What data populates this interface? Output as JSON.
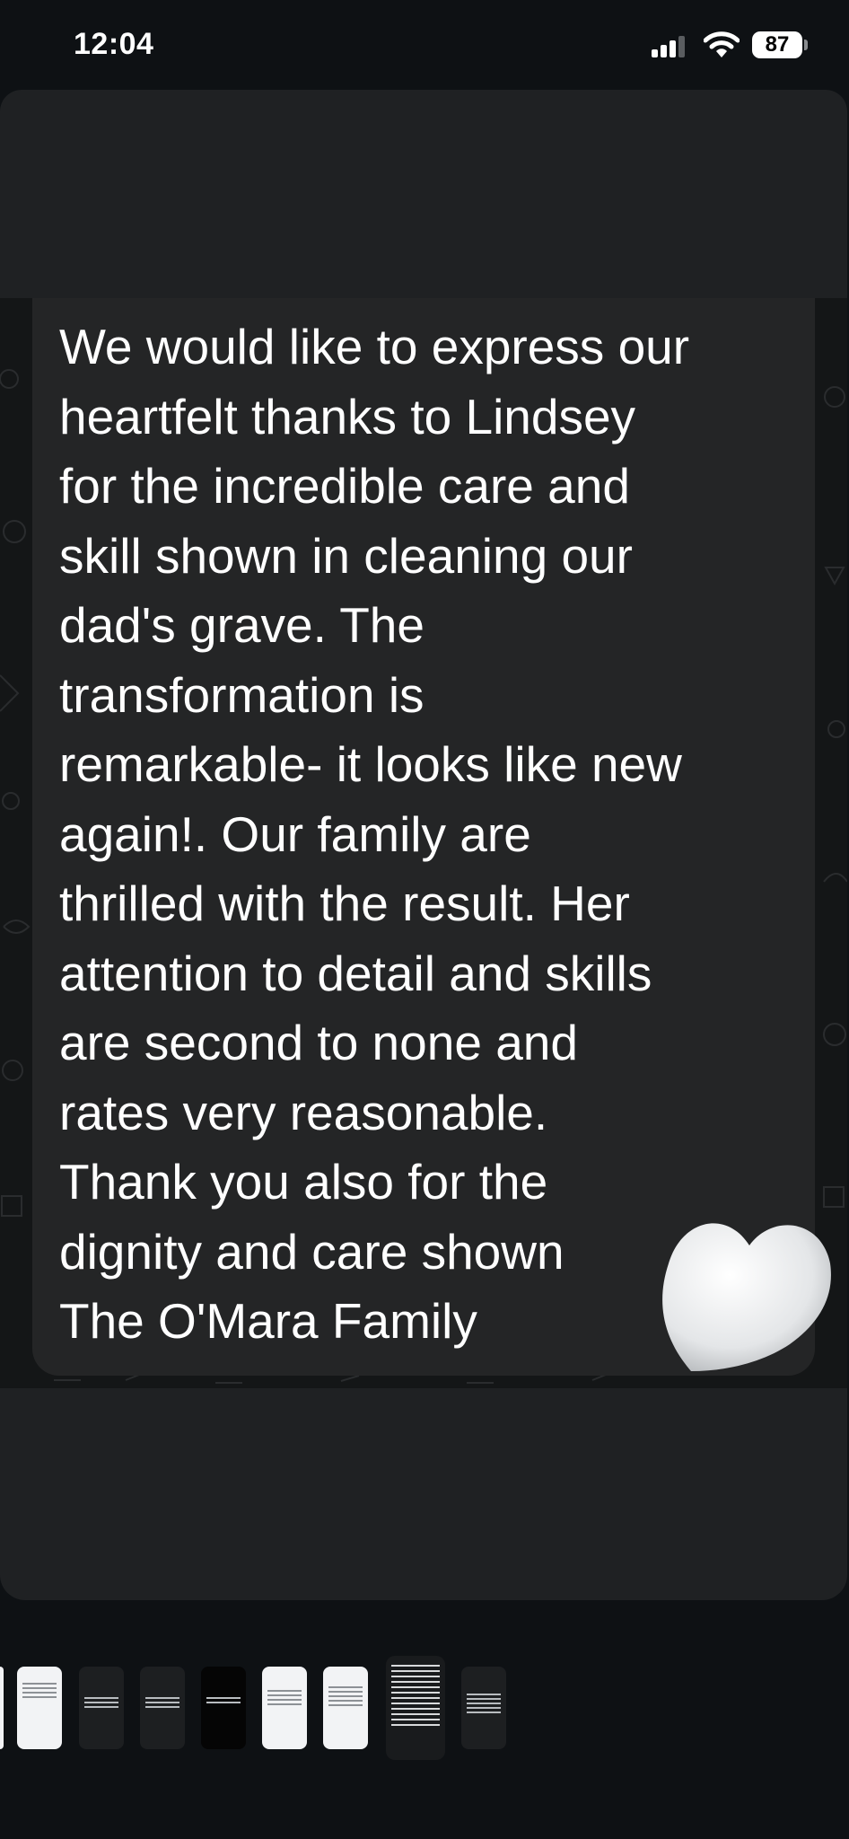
{
  "status_bar": {
    "time": "12:04",
    "battery_level": "87",
    "icons": [
      "cellular-signal-icon",
      "wifi-icon",
      "battery-icon"
    ]
  },
  "message": {
    "text": "We would like to express our\nheartfelt thanks to Lindsey\nfor the incredible care and\nskill shown in cleaning our\ndad's grave. The\ntransformation is\nremarkable- it looks like new\nagain!. Our family are\nthrilled with the result. Her\nattention to detail and skills\nare second to none and\nrates very reasonable.\nThank you also for the\ndignity and care shown\nThe O'Mara Family",
    "emoji": "white-heart-icon"
  },
  "thumbnails": {
    "count": 8,
    "selected_index": 6
  },
  "colors": {
    "background": "#0e1114",
    "card": "#1f2123",
    "bubble": "#242526",
    "text": "#ffffff"
  }
}
